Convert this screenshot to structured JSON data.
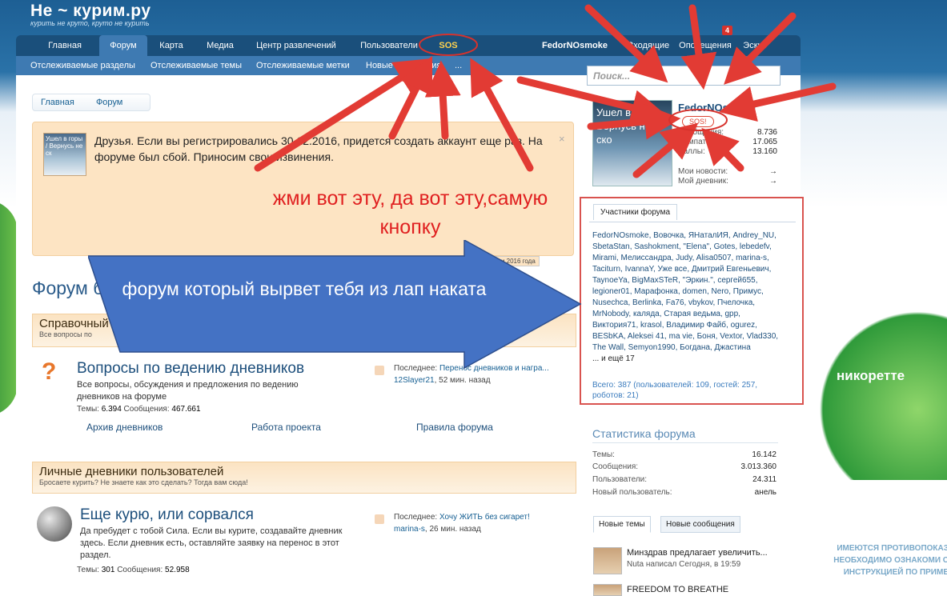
{
  "header": {
    "logo_text": "Не ~ курим.ру",
    "logo_tagline": "курить не круто, круто не курить",
    "nav": [
      "Главная",
      "Форум",
      "Карта",
      "Медиа",
      "Центр развлечений",
      "Пользователи",
      "SOS",
      "FedorNOsmoke",
      "Входящие",
      "Оповещения",
      "Эскиз"
    ],
    "notification_count": "4",
    "subnav": [
      "Отслеживаемые разделы",
      "Отслеживаемые темы",
      "Отслеживаемые метки",
      "Новые сообщения",
      "..."
    ],
    "search_placeholder": "Поиск..."
  },
  "breadcrumb": [
    "Главная",
    "Форум"
  ],
  "notice": {
    "thumb_text": "Ушел в горы / Вернусь не ск",
    "text": "Друзья. Если вы регистрировались 30.12.2016, придется создать аккаунт еще раз. На форуме был сбой. Приносим свои извинения.",
    "close": "×",
    "tag": "Сбои на форуме в итоги 2016 года"
  },
  "annotations": {
    "red_note": "жми вот эту, да вот эту,самую кнопку",
    "arrow_text": "форум который вырвет тебя из лап наката"
  },
  "forum_title": "Форум бр",
  "categories": [
    {
      "title": "Справочный",
      "desc": "Все вопросы по"
    },
    {
      "title": "Личные дневники пользователей",
      "desc": "Бросаете курить? Не знаете как это сделать? Тогда вам сюда!"
    }
  ],
  "nodes": [
    {
      "title": "Вопросы по ведению дневников",
      "desc": "Все вопросы, обсуждения и предложения по ведению дневников на форуме",
      "stats_label_threads": "Темы:",
      "threads": "6.394",
      "stats_label_posts": "Сообщения:",
      "posts": "467.661",
      "last_label": "Последнее:",
      "last_title": "Перенос дневников и награ...",
      "last_user": "12Slayer21",
      "last_time": "52 мин. назад",
      "subforums": [
        "Архив дневников",
        "Работа проекта",
        "Правила форума"
      ]
    },
    {
      "title": "Еще курю, или сорвался",
      "desc": "Да пребудет с тобой Сила. Если вы курите, создавайте дневник здесь. Если дневник есть, оставляйте заявку на перенос в этот раздел.",
      "stats_label_threads": "Темы:",
      "threads": "301",
      "stats_label_posts": "Сообщения:",
      "posts": "52.958",
      "last_label": "Последнее:",
      "last_title": "Хочу ЖИТЬ без сигарет!",
      "last_user": "marina-s",
      "last_time": "26 мин. назад"
    }
  ],
  "user": {
    "avatar_text": "Ушел в горы Вернусь не ско",
    "name": "FedorNOsmoke",
    "sos": "SOS!",
    "rows": [
      {
        "label": "Сообщения:",
        "value": "8.736"
      },
      {
        "label": "Симпатии:",
        "value": "17.065"
      },
      {
        "label": "Баллы:",
        "value": "13.160"
      },
      {
        "label": "Мои новости:",
        "value": "→"
      },
      {
        "label": "Мой дневник:",
        "value": "→"
      }
    ]
  },
  "members": {
    "tab": "Участники форума",
    "list": "FedorNOsmoke, Вовочка, ЯНаталИЯ, Andrey_NU, SbetaStan, Sashokment, \"Elena\", Gotes, lebedefv, Mirami, Мелиссандра, Judy, Alisa0507, marina-s, Taciturn, IvannaY, Уже все, Дмитрий Евгеньевич, TaynoeYa, BigMaxSTeR, \"Эркин.\", сергей655, legioner01, Марафонка, domen, Nero, Примус, Nusechca, Berlinka, Fa76, vbykov, Пчелочка, MrNobody, каляда, Старая ведьма, gpp, Виктория71, krasol, Владимир Файб, ogurez, BESbKA, Aleksei 41, ma vie, Боня, Vextor, Vlad330, The Wall, Semyon1990, Богдана, Джастина",
    "more": "... и ещё 17",
    "total": "Всего: 387 (пользователей: 109, гостей: 257, роботов: 21)"
  },
  "stats": {
    "title": "Статистика форума",
    "rows": [
      {
        "label": "Темы:",
        "value": "16.142"
      },
      {
        "label": "Сообщения:",
        "value": "3.013.360"
      },
      {
        "label": "Пользователи:",
        "value": "24.311"
      },
      {
        "label": "Новый пользователь:",
        "value": "анель"
      }
    ]
  },
  "new_tabs": [
    "Новые темы",
    "Новые сообщения"
  ],
  "threads": [
    {
      "title": "Минздрав предлагает увеличить...",
      "meta": "Nuta написал Сегодня, в 19:59"
    },
    {
      "title": "FREEDOM TO BREATHE",
      "meta": ""
    }
  ],
  "ad": {
    "logo": "никоретте",
    "warning": "ИМЕЮТСЯ ПРОТИВОПОКАЗ НЕОБХОДИМО ОЗНАКОМИ С ИНСТРУКЦИЕЙ ПО ПРИМЕ"
  }
}
